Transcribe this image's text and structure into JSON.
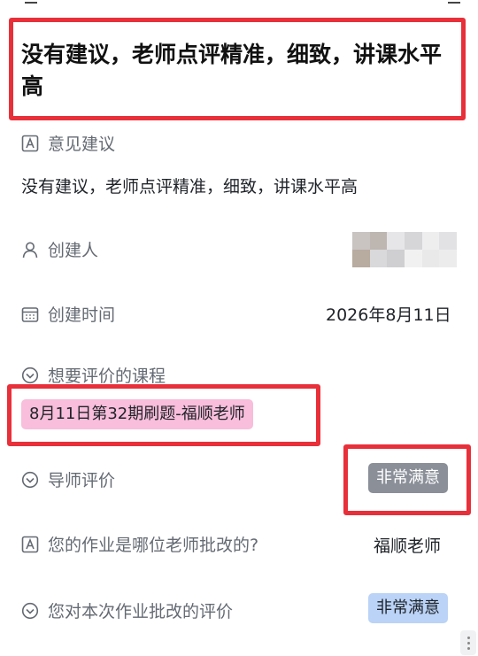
{
  "title": "没有建议，老师点评精准，细致，讲课水平高",
  "fields": {
    "suggestion": {
      "label": "意见建议",
      "icon": "text-field-icon",
      "value": "没有建议，老师点评精准，细致，讲课水平高"
    },
    "creator": {
      "label": "创建人",
      "icon": "person-icon",
      "value_blurred": true
    },
    "created_time": {
      "label": "创建时间",
      "icon": "calendar-icon",
      "value": "2026年8月11日"
    },
    "course": {
      "label": "想要评价的课程",
      "icon": "chevron-circle-icon",
      "value": "8月11日第32期刷题-福顺老师"
    },
    "mentor_rating": {
      "label": "导师评价",
      "icon": "chevron-circle-icon",
      "value": "非常满意"
    },
    "grader": {
      "label": "您的作业是哪位老师批改的?",
      "icon": "text-field-icon",
      "value": "福顺老师"
    },
    "grading_rating": {
      "label": "您对本次作业批改的评价",
      "icon": "chevron-circle-icon",
      "value": "非常满意"
    }
  },
  "colors": {
    "highlight_red": "#e8303a",
    "tag_pink": "#f8bedb",
    "tag_gray": "#8a8f98",
    "tag_blue": "#bad3f7",
    "label_gray": "#646a73"
  }
}
